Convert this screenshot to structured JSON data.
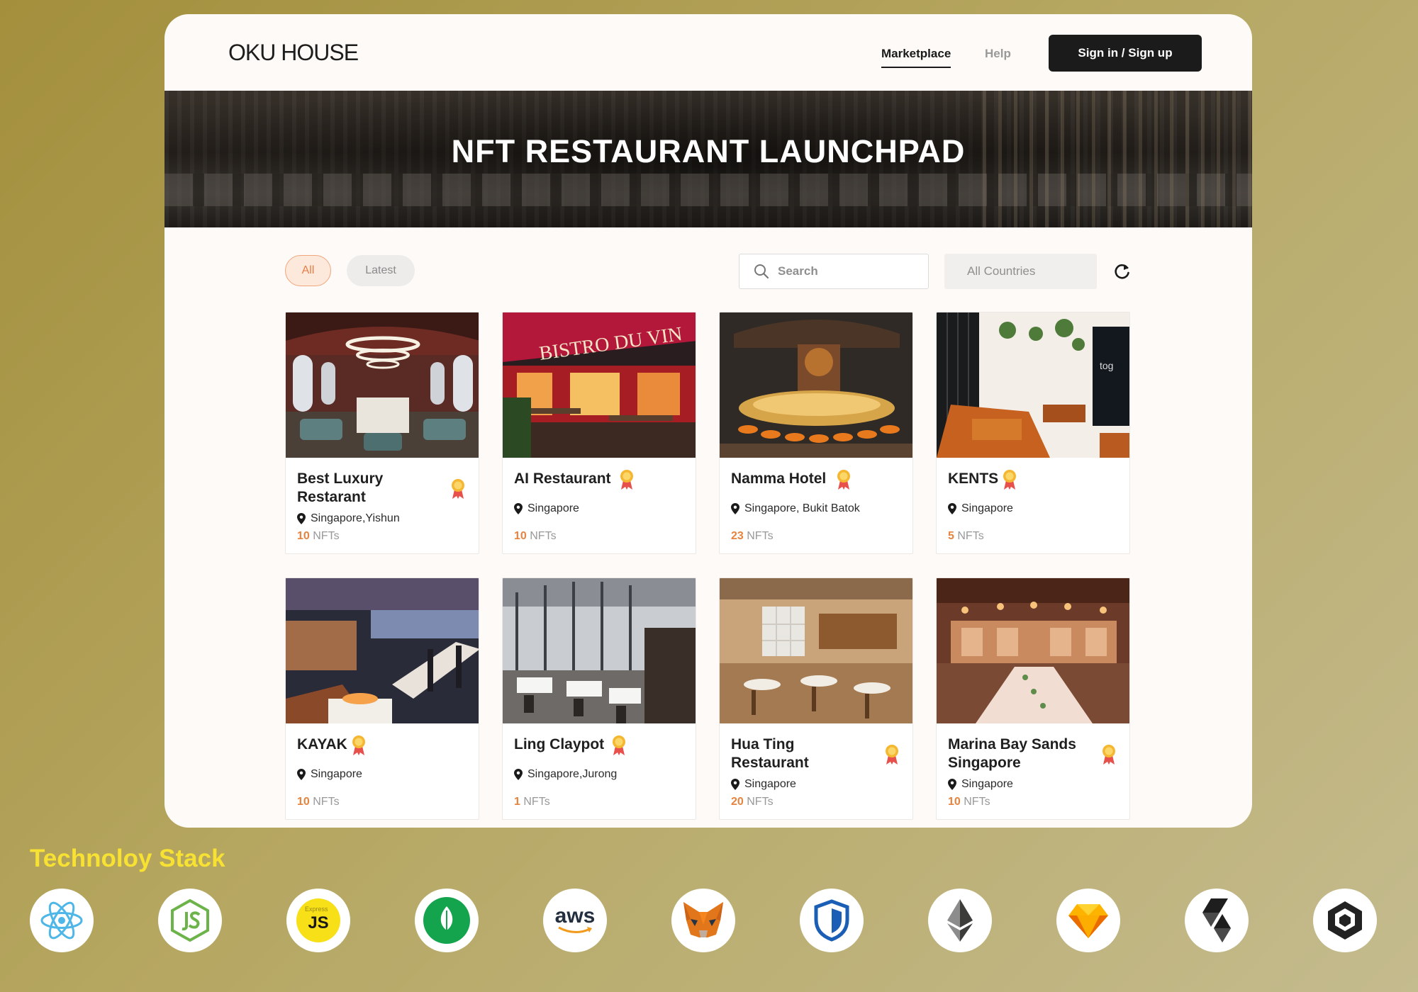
{
  "header": {
    "logo": "OKU HOUSE",
    "nav": [
      {
        "label": "Marketplace",
        "active": true
      },
      {
        "label": "Help",
        "active": false
      }
    ],
    "signin_label": "Sign in / Sign up"
  },
  "hero": {
    "title": "NFT RESTAURANT LAUNCHPAD"
  },
  "filters": {
    "tabs": [
      {
        "label": "All",
        "active": true
      },
      {
        "label": "Latest",
        "active": false
      }
    ],
    "search_placeholder": "Search",
    "country_selected": "All Countries"
  },
  "restaurants": [
    {
      "name": "Best Luxury Restarant",
      "location": "Singapore,Yishun",
      "nft_count": "10",
      "nft_unit": "NFTs"
    },
    {
      "name": "AI Restaurant",
      "location": "Singapore",
      "nft_count": "10",
      "nft_unit": "NFTs"
    },
    {
      "name": "Namma Hotel",
      "location": "Singapore, Bukit Batok",
      "nft_count": "23",
      "nft_unit": "NFTs"
    },
    {
      "name": "KENTS",
      "location": "Singapore",
      "nft_count": "5",
      "nft_unit": "NFTs"
    },
    {
      "name": "KAYAK",
      "location": "Singapore",
      "nft_count": "10",
      "nft_unit": "NFTs"
    },
    {
      "name": "Ling Claypot",
      "location": "Singapore,Jurong",
      "nft_count": "1",
      "nft_unit": "NFTs"
    },
    {
      "name": "Hua Ting Restaurant",
      "location": "Singapore",
      "nft_count": "20",
      "nft_unit": "NFTs"
    },
    {
      "name": "Marina Bay Sands Singapore",
      "location": "Singapore",
      "nft_count": "10",
      "nft_unit": "NFTs"
    }
  ],
  "photo_texts": {
    "bistro_sign": "BISTRO DU VIN",
    "kents_logo": "tog"
  },
  "tech_stack": {
    "title": "Technoloy Stack",
    "icons": [
      "react-icon",
      "nodejs-icon",
      "expressjs-icon",
      "mongodb-icon",
      "aws-icon",
      "metamask-icon",
      "openzeppelin-icon",
      "ethereum-icon",
      "sketch-icon",
      "solidity-icon",
      "unity-icon"
    ],
    "labels": {
      "express_js": "JS",
      "express_small": "Express",
      "aws": "aws"
    }
  },
  "colors": {
    "accent": "#e6833f",
    "dark": "#1b1b1b",
    "tech_title": "#f7e132",
    "badge": "#f5b731"
  }
}
